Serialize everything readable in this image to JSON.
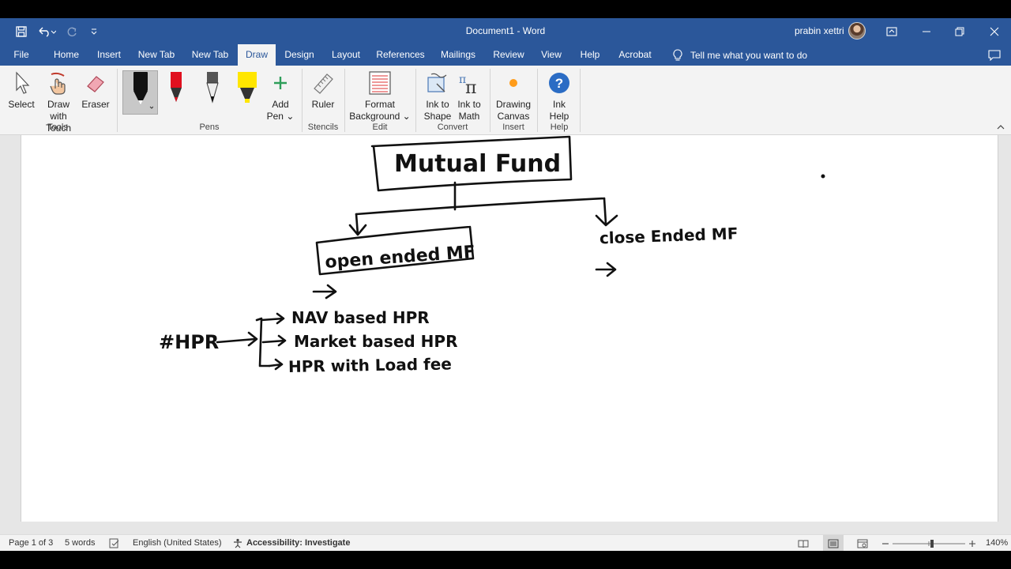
{
  "window": {
    "title": "Document1  -  Word",
    "user": "prabin xettri"
  },
  "menu": {
    "file": "File",
    "tabs": [
      "Home",
      "Insert",
      "New Tab",
      "New Tab",
      "Draw",
      "Design",
      "Layout",
      "References",
      "Mailings",
      "Review",
      "View",
      "Help",
      "Acrobat"
    ],
    "active_tab": "Draw",
    "tell_me": "Tell me what you want to do"
  },
  "ribbon": {
    "select": "Select",
    "draw_touch_1": "Draw with",
    "draw_touch_2": "Touch",
    "eraser": "Eraser",
    "add_pen_1": "Add",
    "add_pen_2": "Pen",
    "ruler": "Ruler",
    "format_bg_1": "Format",
    "format_bg_2": "Background",
    "ink_shape_1": "Ink to",
    "ink_shape_2": "Shape",
    "ink_math_1": "Ink to",
    "ink_math_2": "Math",
    "drawing_canvas_1": "Drawing",
    "drawing_canvas_2": "Canvas",
    "ink_help_1": "Ink",
    "ink_help_2": "Help",
    "groups": {
      "tools": "Tools",
      "pens": "Pens",
      "stencils": "Stencils",
      "edit": "Edit",
      "convert": "Convert",
      "insert": "Insert",
      "help": "Help"
    },
    "pen_colors": [
      "#111111",
      "#e0101f",
      "#555555",
      "#ffe600"
    ]
  },
  "document": {
    "ink_texts": [
      "Mutual Fund",
      "open ended MF",
      "close Ended MF",
      "#HPR",
      "NAV based HPR",
      "Market based HPR",
      "HPR with Load fee"
    ]
  },
  "status": {
    "page": "Page 1 of 3",
    "words": "5 words",
    "language": "English (United States)",
    "accessibility": "Accessibility: Investigate",
    "zoom": "140%"
  },
  "colors": {
    "title_bar": "#2b579a",
    "ribbon_bg": "#f3f3f3",
    "accent_blue": "#2b6cc4"
  }
}
